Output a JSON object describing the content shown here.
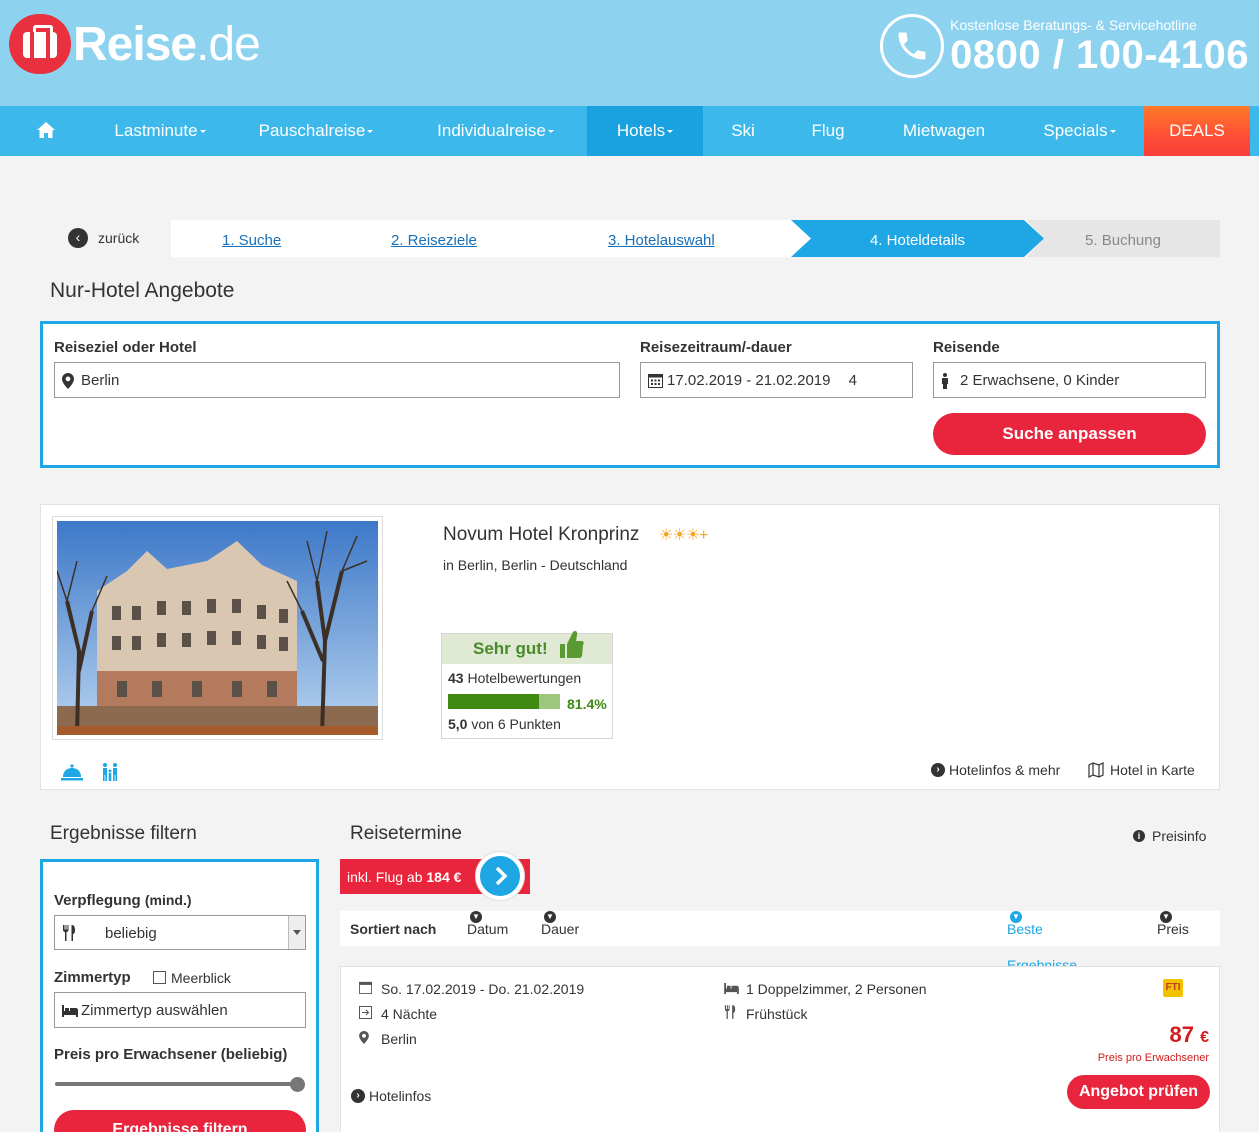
{
  "header": {
    "logo_main": "Reise",
    "logo_suffix": ".de",
    "hotline_label": "Kostenlose Beratungs- & Servicehotline",
    "hotline_number": "0800 / 100-4106"
  },
  "nav": {
    "items": [
      {
        "label": "Lastminute"
      },
      {
        "label": "Pauschalreise"
      },
      {
        "label": "Individualreise"
      },
      {
        "label": "Hotels"
      },
      {
        "label": "Ski"
      },
      {
        "label": "Flug"
      },
      {
        "label": "Mietwagen"
      },
      {
        "label": "Specials"
      },
      {
        "label": "DEALS"
      }
    ]
  },
  "steps": {
    "back_label": "zurück",
    "items": [
      "1. Suche",
      "2. Reiseziele",
      "3. Hotelauswahl",
      "4. Hoteldetails",
      "5. Buchung"
    ]
  },
  "search": {
    "title": "Nur-Hotel Angebote",
    "destination_label": "Reiseziel oder Hotel",
    "destination_value": "Berlin",
    "period_label": "Reisezeitraum/-dauer",
    "period_value": "17.02.2019 - 21.02.2019",
    "duration_value": "4",
    "travelers_label": "Reisende",
    "travelers_value": "2 Erwachsene, 0 Kinder",
    "submit_label": "Suche anpassen"
  },
  "hotel": {
    "name": "Novum Hotel Kronprinz",
    "stars": "☀☀☀+",
    "location": "in Berlin, Berlin - Deutschland",
    "rating_label": "Sehr gut!",
    "review_count": "43",
    "review_label": "Hotelbewertungen",
    "recommend_pct": "81.4%",
    "recommend_fraction": 0.814,
    "score": "5,0",
    "score_suffix": "von 6 Punkten",
    "info_link": "Hotelinfos & mehr",
    "map_link": "Hotel in Karte",
    "amenity_icons": [
      "service-bell-icon",
      "family-icon"
    ]
  },
  "filter": {
    "title": "Ergebnisse filtern",
    "board_label": "Verpflegung",
    "board_hint": "(mind.)",
    "board_value": "beliebig",
    "room_label": "Zimmertyp",
    "seaview_label": "Meerblick",
    "room_placeholder": "Zimmertyp auswählen",
    "price_label": "Preis pro Erwachsener (beliebig)",
    "submit_label": "Ergebnisse filtern"
  },
  "results": {
    "title": "Reisetermine",
    "price_info": "Preisinfo",
    "flight_prefix": "inkl. Flug ab",
    "flight_price": "184 €",
    "sort_label": "Sortiert nach",
    "sort_date": "Datum",
    "sort_duration": "Dauer",
    "sort_best": "Beste Ergebnisse",
    "sort_price": "Preis"
  },
  "offer": {
    "dates": "So. 17.02.2019 - Do. 21.02.2019",
    "nights": "4 Nächte",
    "city": "Berlin",
    "room": "1 Doppelzimmer, 2 Personen",
    "board": "Frühstück",
    "provider_logo": "FTI",
    "price": "87",
    "currency": "€",
    "price_note": "Preis pro Erwachsener",
    "hotelinfo_link": "Hotelinfos",
    "cta": "Angebot prüfen"
  },
  "colors": {
    "header_bg": "#8dd3f0",
    "nav_bg": "#3cb8ea",
    "accent_blue": "#1ea7e4",
    "brand_red": "#e8253c",
    "rating_green": "#3f8a12"
  }
}
